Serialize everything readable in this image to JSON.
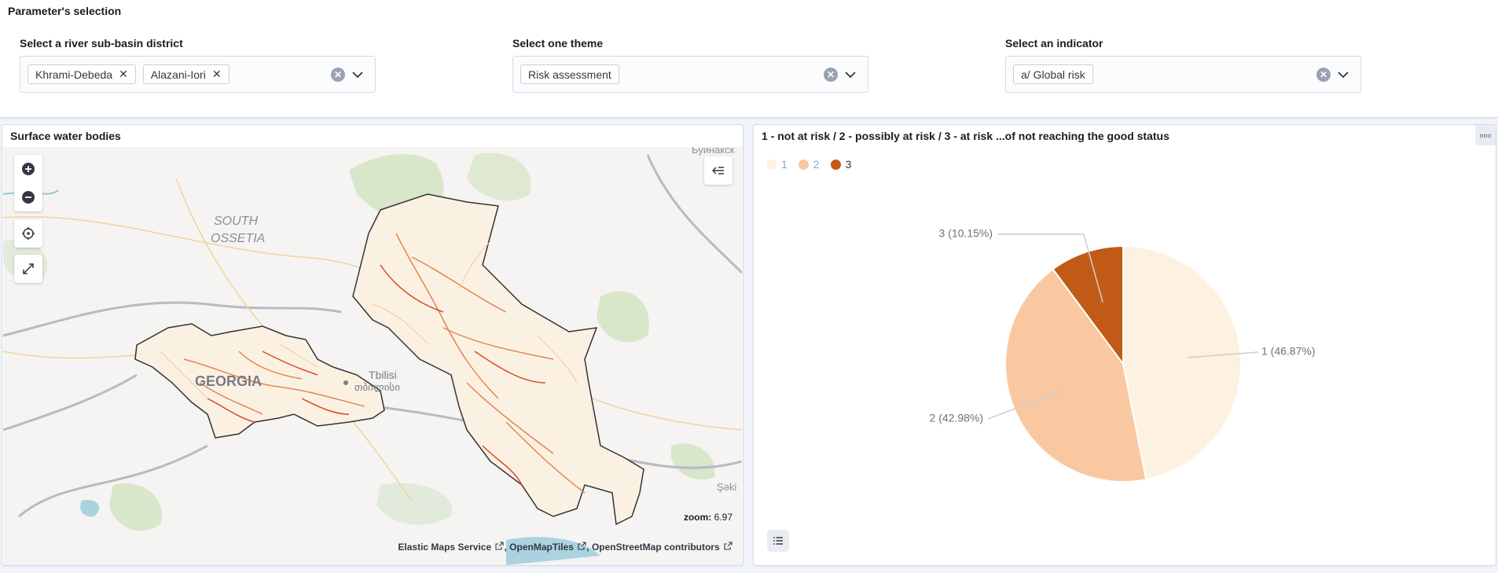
{
  "controls": {
    "title": "Parameter's selection",
    "district": {
      "label": "Select a river sub-basin district",
      "chips": [
        "Khrami-Debeda",
        "Alazani-Iori"
      ]
    },
    "theme": {
      "label": "Select one theme",
      "chips": [
        "Risk assessment"
      ]
    },
    "indicator": {
      "label": "Select an indicator",
      "chips": [
        "a/ Global risk"
      ]
    }
  },
  "map": {
    "title": "Surface water bodies",
    "labels": {
      "south_ossetia_1": "SOUTH",
      "south_ossetia_2": "OSSETIA",
      "georgia": "GEORGIA",
      "tbilisi_1": "Tbilisi",
      "tbilisi_2": "თბილისი",
      "buinaksk": "Буйнакск",
      "saki": "Şəki"
    },
    "zoom_label": "zoom:",
    "zoom_value": "6.97",
    "attribution": [
      "Elastic Maps Service",
      "OpenMapTiles",
      "OpenStreetMap contributors"
    ],
    "icons": [
      "plus-icon",
      "minus-icon",
      "locate-icon",
      "expand-icon",
      "layers-collapse-icon"
    ]
  },
  "chart": {
    "title": "1 - not at risk / 2 - possibly at risk / 3 - at risk ...of not reaching the good status",
    "legend": [
      "1",
      "2",
      "3"
    ]
  },
  "chart_data": {
    "type": "pie",
    "categories": [
      "1",
      "2",
      "3"
    ],
    "values": [
      46.87,
      42.98,
      10.15
    ],
    "slice_labels": [
      "1 (46.87%)",
      "2 (42.98%)",
      "3 (10.15%)"
    ],
    "colors": [
      "#fdf1e1",
      "#f9c8a0",
      "#c25a17"
    ],
    "legend_position": "top-left"
  }
}
